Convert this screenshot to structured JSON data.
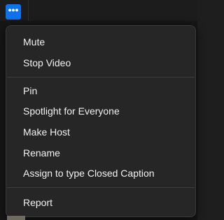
{
  "toolbar": {
    "more_button_label": "•••",
    "more_button_color": "#0e72ed"
  },
  "menu": {
    "groups": [
      {
        "items": [
          {
            "label": "Mute"
          },
          {
            "label": "Stop Video"
          }
        ]
      },
      {
        "items": [
          {
            "label": "Pin"
          },
          {
            "label": "Spotlight for Everyone"
          },
          {
            "label": "Make Host"
          },
          {
            "label": "Rename"
          },
          {
            "label": "Assign to type Closed Caption"
          }
        ]
      },
      {
        "items": [
          {
            "label": "Report"
          }
        ]
      }
    ]
  },
  "colors": {
    "menu_background": "#262626",
    "menu_text": "#f2f2f2",
    "divider": "#3c3c3c"
  }
}
